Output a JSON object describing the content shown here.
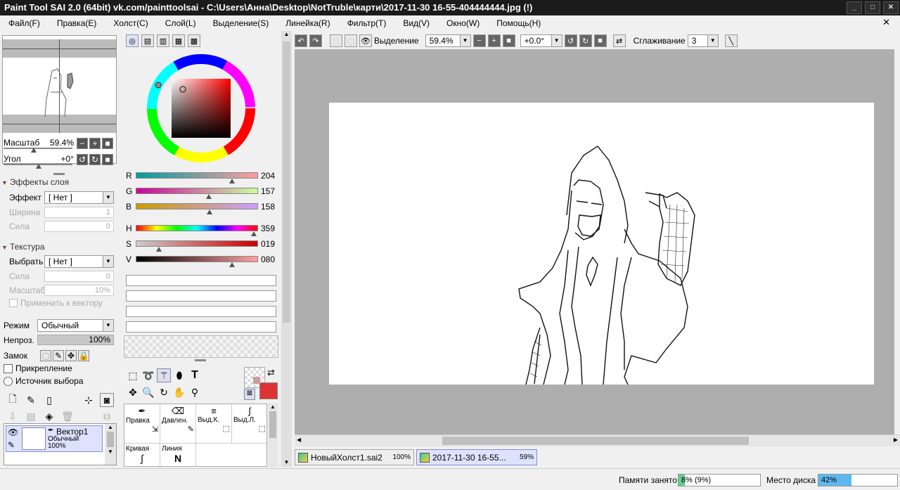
{
  "window": {
    "title": "Paint Tool SAI 2.0 (64bit) vk.com/painttoolsai - C:\\Users\\Анна\\Desktop\\NotTruble\\карти\\2017-11-30 16-55-404444444.jpg (!)",
    "close_symbol": "✕"
  },
  "menu": [
    "Файл(F)",
    "Правка(E)",
    "Холст(C)",
    "Слой(L)",
    "Выделение(S)",
    "Линейка(R)",
    "Фильтр(T)",
    "Вид(V)",
    "Окно(W)",
    "Помощь(H)"
  ],
  "navigator": {
    "scale_label": "Масштаб",
    "scale_value": "59.4%",
    "angle_label": "Угол",
    "angle_value": "+0°"
  },
  "layer_effects": {
    "section": "Эффекты слоя",
    "effect_label": "Эффект",
    "effect_value": "[ Нет ]",
    "width_label": "Ширина",
    "width_value": "1",
    "strength_label": "Сила",
    "strength_value": "0"
  },
  "texture": {
    "section": "Текстура",
    "select_label": "Выбрать",
    "select_value": "[ Нет ]",
    "strength_label": "Сила",
    "strength_value": "0",
    "scale_label": "Масштаб",
    "scale_value": "10%",
    "apply_label": "Применить к вектору"
  },
  "layer": {
    "mode_label": "Режим",
    "mode_value": "Обычный",
    "opacity_label": "Непроз.",
    "opacity_value": "100%",
    "lock_label": "Замок",
    "pin_label": "Прикрепление",
    "source_label": "Источник выбора",
    "name": "Вектор1",
    "blend": "Обычный",
    "opacity": "100%"
  },
  "color": {
    "r": "204",
    "g": "157",
    "b": "158",
    "h": "359",
    "s": "019",
    "v": "080",
    "r_label": "R",
    "g_label": "G",
    "b_label": "B",
    "h_label": "H",
    "s_label": "S",
    "v_label": "V",
    "current": "#cc9d9e",
    "primary": "#dd3333"
  },
  "brushes": [
    {
      "name": "Правка",
      "icon": "pen-icon"
    },
    {
      "name": "Давлен.",
      "icon": "eraser-icon"
    },
    {
      "name": "Выд.К.",
      "icon": "menu-icon"
    },
    {
      "name": "Выд.Л.",
      "icon": "curve-icon"
    },
    {
      "name": "Кривая",
      "icon": "curve-tool-icon"
    },
    {
      "name": "Линия",
      "icon": "line-tool-icon"
    }
  ],
  "toolbar": {
    "selection_label": "Выделение",
    "zoom": "59.4%",
    "angle": "+0.0°",
    "smoothing_label": "Сглаживание",
    "smoothing_value": "3"
  },
  "tabs": [
    {
      "name": "НовыйХолст1.sai2",
      "zoom": "100%"
    },
    {
      "name": "2017-11-30 16-55...",
      "zoom": "59%"
    }
  ],
  "status": {
    "memory_label": "Памяти занято",
    "memory_value": "8% (9%)",
    "memory_fill": 0.08,
    "disk_label": "Место диска",
    "disk_value": "42%",
    "disk_fill": 0.42
  }
}
